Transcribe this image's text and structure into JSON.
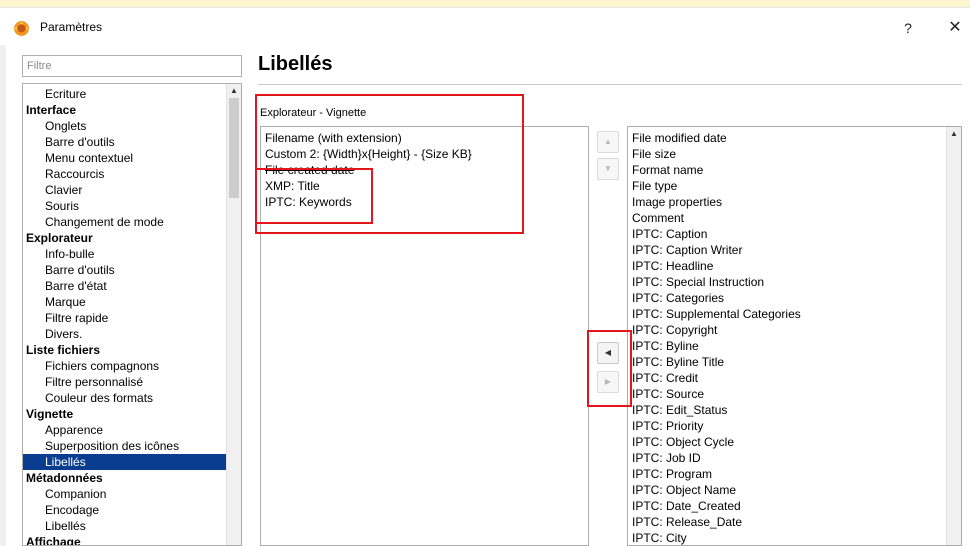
{
  "window": {
    "title": "Paramètres",
    "help_label": "?",
    "close_label": "✕"
  },
  "filter": {
    "placeholder": "Filtre"
  },
  "tree": {
    "items": [
      {
        "label": "Ecriture",
        "type": "child"
      },
      {
        "label": "Interface",
        "type": "category"
      },
      {
        "label": "Onglets",
        "type": "child"
      },
      {
        "label": "Barre d'outils",
        "type": "child"
      },
      {
        "label": "Menu contextuel",
        "type": "child"
      },
      {
        "label": "Raccourcis",
        "type": "child"
      },
      {
        "label": "Clavier",
        "type": "child"
      },
      {
        "label": "Souris",
        "type": "child"
      },
      {
        "label": "Changement de mode",
        "type": "child"
      },
      {
        "label": "Explorateur",
        "type": "category"
      },
      {
        "label": "Info-bulle",
        "type": "child"
      },
      {
        "label": "Barre d'outils",
        "type": "child"
      },
      {
        "label": "Barre d'état",
        "type": "child"
      },
      {
        "label": "Marque",
        "type": "child"
      },
      {
        "label": "Filtre rapide",
        "type": "child"
      },
      {
        "label": "Divers.",
        "type": "child"
      },
      {
        "label": "Liste fichiers",
        "type": "category"
      },
      {
        "label": "Fichiers compagnons",
        "type": "child"
      },
      {
        "label": "Filtre personnalisé",
        "type": "child"
      },
      {
        "label": "Couleur des formats",
        "type": "child"
      },
      {
        "label": "Vignette",
        "type": "category"
      },
      {
        "label": "Apparence",
        "type": "child"
      },
      {
        "label": "Superposition des icônes",
        "type": "child"
      },
      {
        "label": "Libellés",
        "type": "child",
        "selected": true
      },
      {
        "label": "Métadonnées",
        "type": "category"
      },
      {
        "label": "Companion",
        "type": "child"
      },
      {
        "label": "Encodage",
        "type": "child"
      },
      {
        "label": "Libellés",
        "type": "child"
      },
      {
        "label": "Affichage",
        "type": "category"
      }
    ]
  },
  "page": {
    "title": "Libellés",
    "section_label": "Explorateur - Vignette"
  },
  "selected_fields": [
    {
      "label": "Filename (with extension)"
    },
    {
      "label": "Custom 2: {Width}x{Height} - {Size KB}"
    },
    {
      "label": "File created date",
      "struck": true
    },
    {
      "label": "XMP: Title"
    },
    {
      "label": "IPTC: Keywords"
    }
  ],
  "available_fields": [
    "File modified date",
    "File size",
    "Format name",
    "File type",
    "Image properties",
    "Comment",
    "IPTC: Caption",
    "IPTC: Caption Writer",
    "IPTC: Headline",
    "IPTC: Special Instruction",
    "IPTC: Categories",
    "IPTC: Supplemental Categories",
    "IPTC: Copyright",
    "IPTC: Byline",
    "IPTC: Byline Title",
    "IPTC: Credit",
    "IPTC: Source",
    "IPTC: Edit_Status",
    "IPTC: Priority",
    "IPTC: Object Cycle",
    "IPTC: Job ID",
    "IPTC: Program",
    "IPTC: Object Name",
    "IPTC: Date_Created",
    "IPTC: Release_Date",
    "IPTC: City"
  ],
  "buttons": {
    "move_up": "▲",
    "move_down": "▼",
    "add_left": "◀",
    "remove_right": "▶"
  },
  "colors": {
    "selection": "#0a3d8f",
    "annotation": "#e4161b"
  }
}
